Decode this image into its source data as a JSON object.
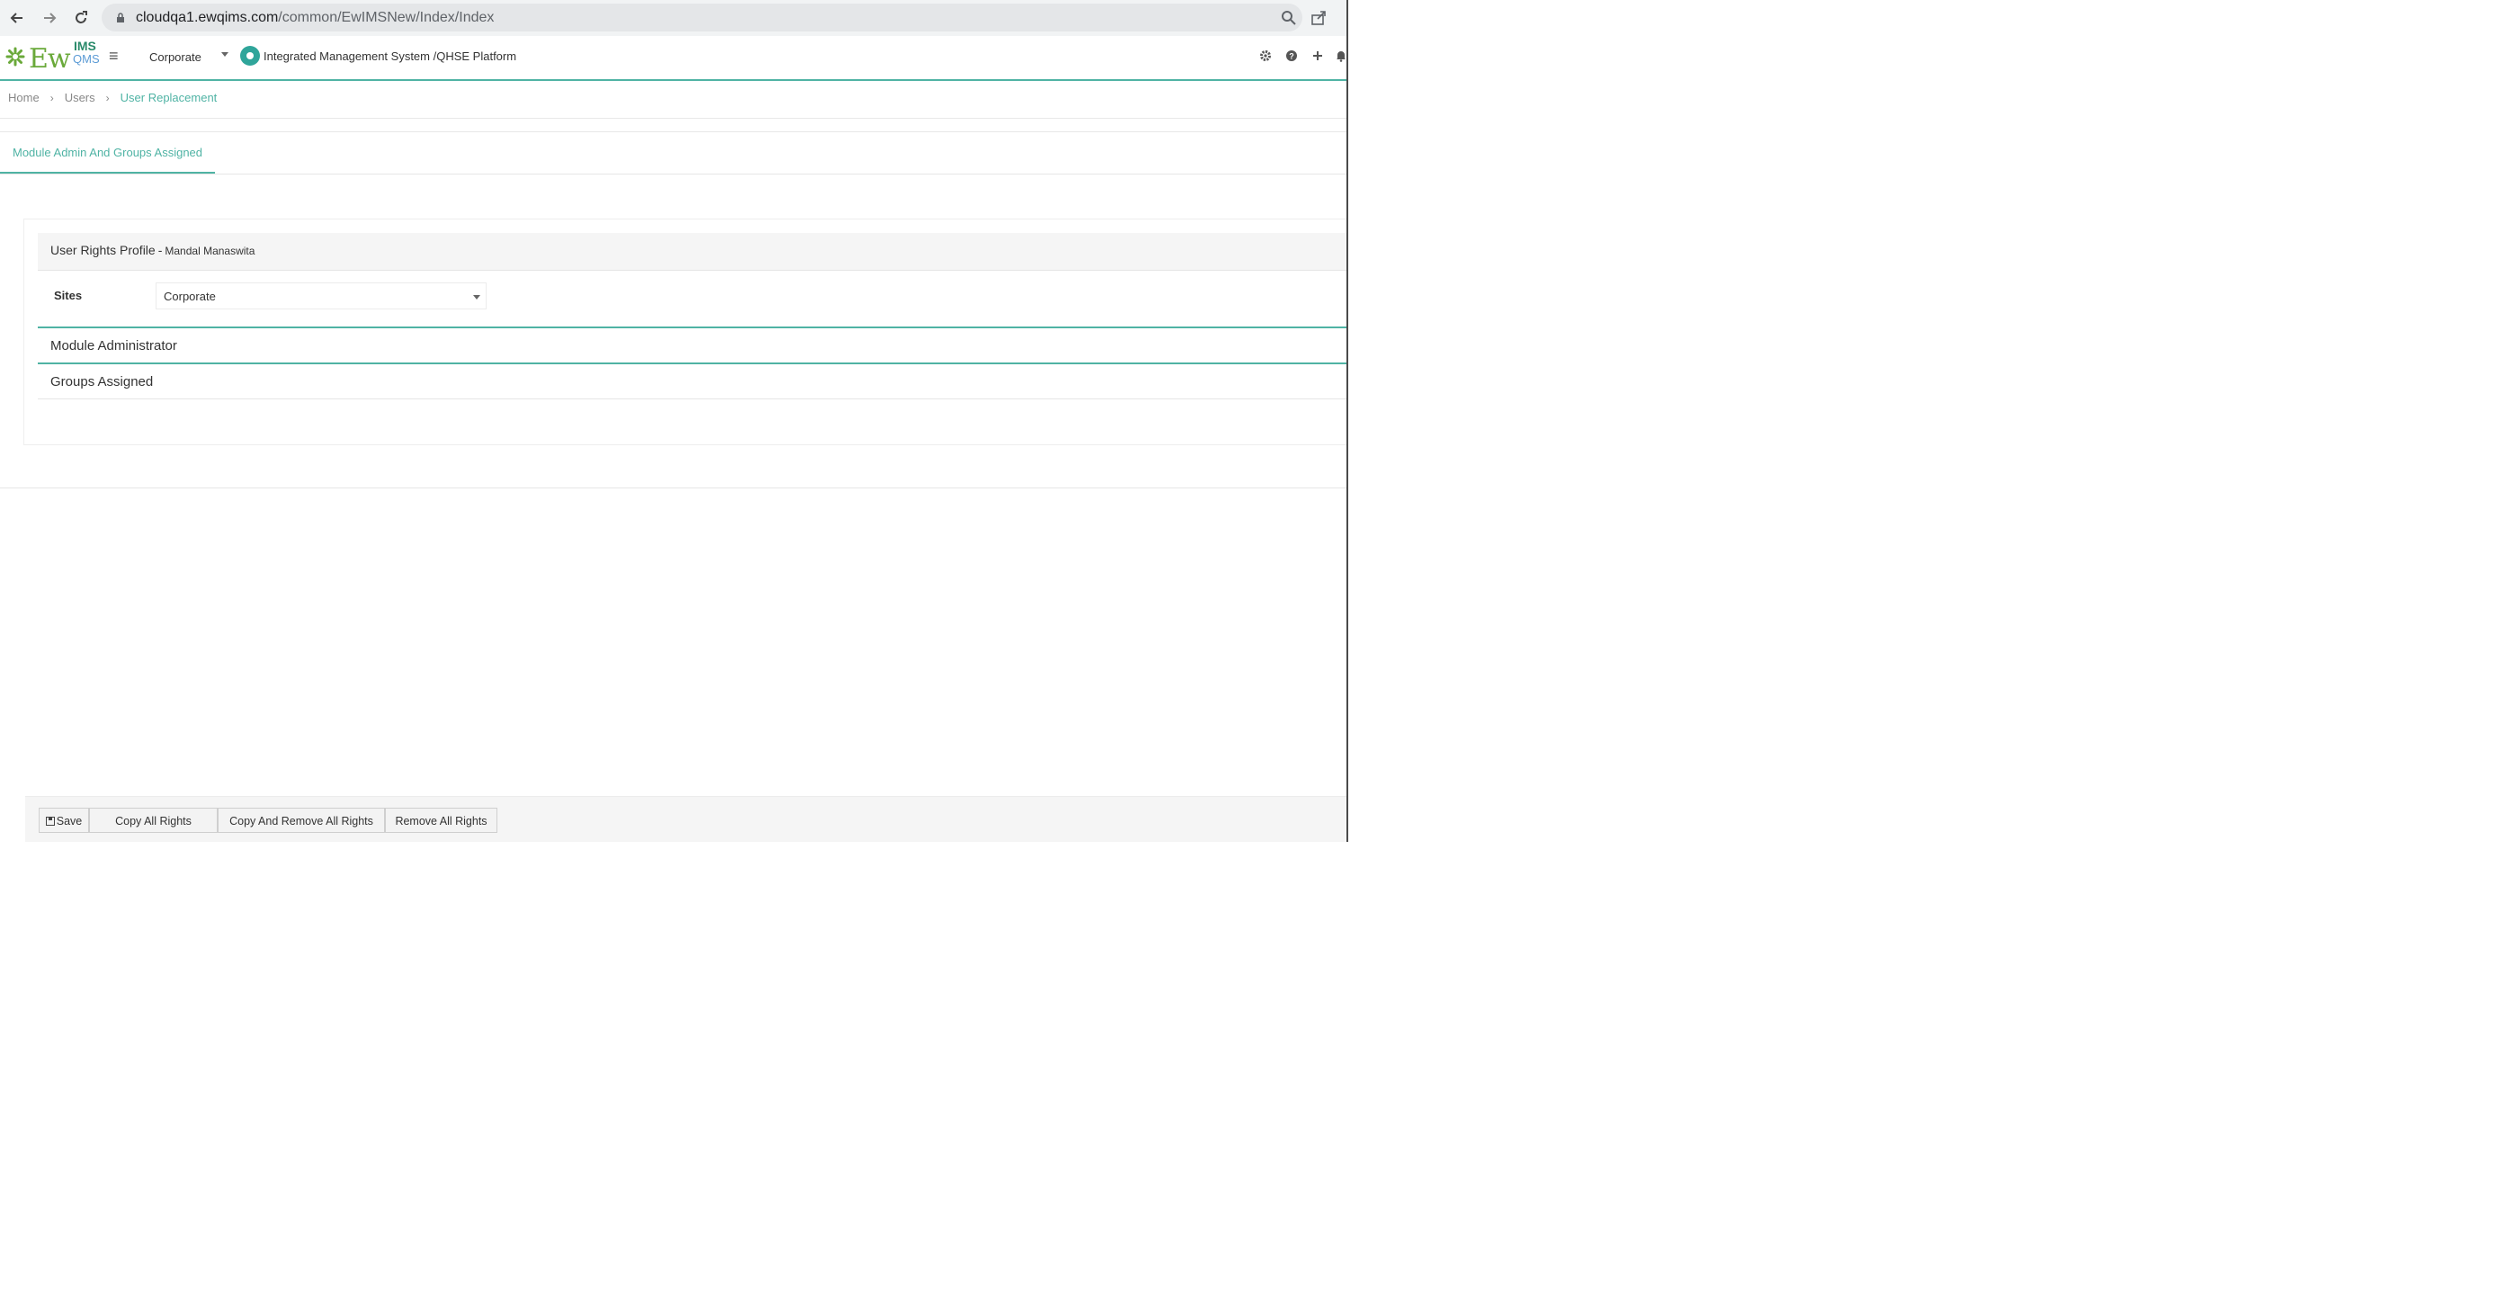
{
  "browser": {
    "url_host": "cloudqa1.ewqims.com",
    "url_path": "/common/EwIMSNew/Index/Index"
  },
  "header": {
    "logo_text": "Ew",
    "logo_sup_top": "IMS",
    "logo_sup_bottom": "QMS",
    "site_selected": "Corporate",
    "platform_title": "Integrated Management System /QHSE Platform",
    "icons": [
      "gear-icon",
      "help-icon",
      "plus-icon",
      "bell-icon"
    ]
  },
  "breadcrumb": {
    "items": [
      "Home",
      "Users"
    ],
    "current": "User Replacement"
  },
  "tabs": [
    {
      "label": "Module Admin And Groups Assigned",
      "active": true
    }
  ],
  "profile": {
    "title": "User Rights Profile",
    "separator": "-",
    "user_name": "Mandal Manaswita"
  },
  "sites": {
    "label": "Sites",
    "selected": "Corporate"
  },
  "sections": {
    "module_admin": "Module Administrator",
    "groups_assigned": "Groups Assigned"
  },
  "footer": {
    "save_label": "Save",
    "copy_all_label": "Copy All Rights",
    "copy_remove_label": "Copy And Remove All Rights",
    "remove_all_label": "Remove All Rights"
  },
  "colors": {
    "accent": "#4fb3a4",
    "logo_green": "#6aa93a"
  }
}
